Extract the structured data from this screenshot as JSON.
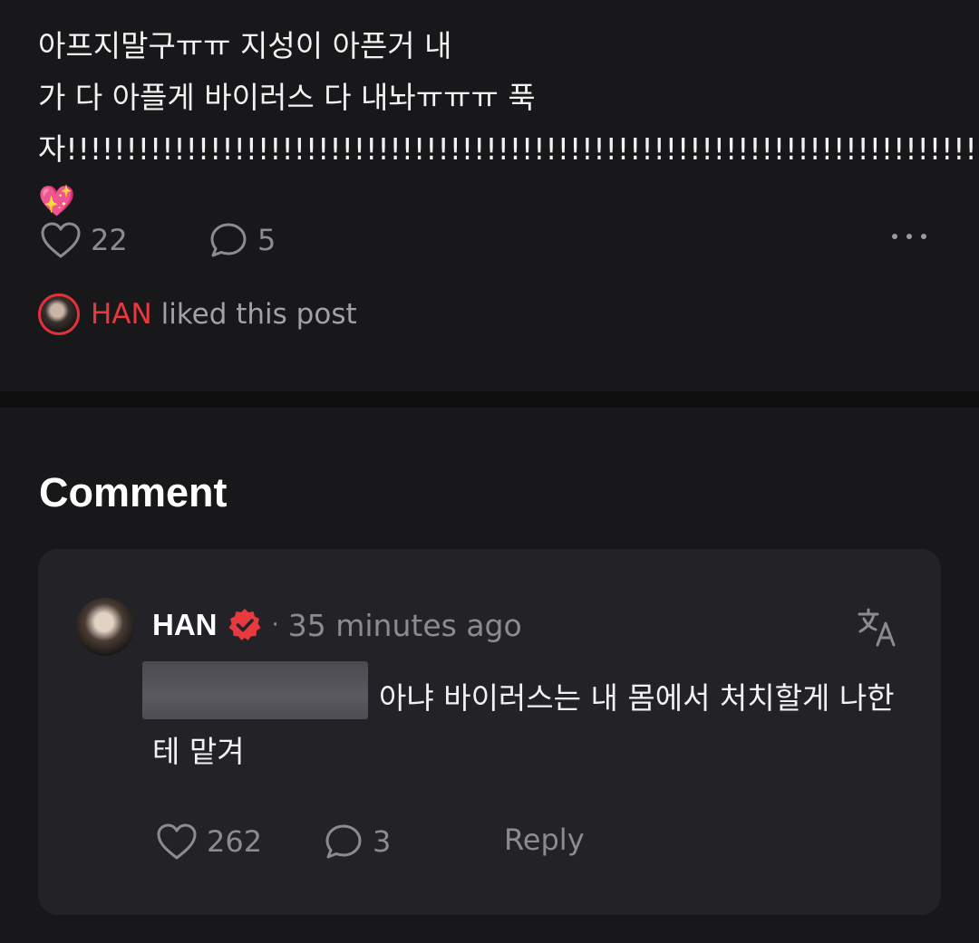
{
  "post": {
    "text": "아프지말구ㅠㅠ 지성이 아픈거 내\n가 다 아플게 바이러스 다 내놔ㅠㅠㅠ 푹\n자!!!!!!!!!!!!!!!!!!!!!!!!!!!!!!!!!!!!!!!!!!!!!!!!!!!!!!!!!!!!!!!!!!!!!!!!!!!!!!!!",
    "emoji": "💖",
    "likes": "22",
    "comments": "5",
    "liked_by": {
      "name": "HAN",
      "suffix": "liked this post"
    }
  },
  "comment_section": {
    "title": "Comment",
    "comment": {
      "author": "HAN",
      "separator": "·",
      "time": "35 minutes ago",
      "text": "아냐 바이러스는 내 몸에서 처치할게 나한테 맡겨",
      "likes": "262",
      "replies": "3",
      "reply_label": "Reply"
    }
  },
  "colors": {
    "accent_red": "#e8393f",
    "muted": "#8c8c90",
    "card_bg": "#232327"
  },
  "icons": [
    "heart-icon",
    "comment-bubble-icon",
    "more-dots-icon",
    "verified-badge-icon",
    "translate-icon"
  ]
}
